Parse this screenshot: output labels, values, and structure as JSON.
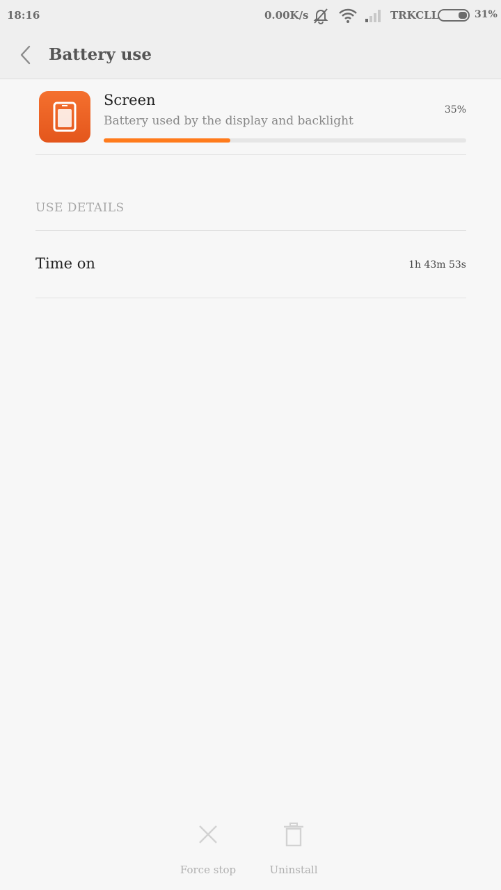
{
  "status_bar": {
    "time": "18:16",
    "network_speed": "0.00K/s",
    "carrier": "TRKCLL",
    "battery_percent": "31%",
    "icons": [
      "silent-alarm-icon",
      "wifi-icon",
      "signal-icon",
      "battery-icon"
    ]
  },
  "header": {
    "back_icon": "chevron-left-icon",
    "title": "Battery use"
  },
  "app": {
    "icon": "phone-screen-icon",
    "name": "Screen",
    "description": "Battery used by the display and backlight",
    "usage_percent_label": "35%",
    "usage_fraction": 0.35,
    "accent_color": "#ff7b1c"
  },
  "use_details": {
    "section_title": "USE DETAILS",
    "rows": [
      {
        "label": "Time on",
        "value": "1h 43m 53s"
      }
    ]
  },
  "actions": {
    "force_stop": {
      "label": "Force stop",
      "icon": "close-x-icon"
    },
    "uninstall": {
      "label": "Uninstall",
      "icon": "trash-icon"
    }
  }
}
